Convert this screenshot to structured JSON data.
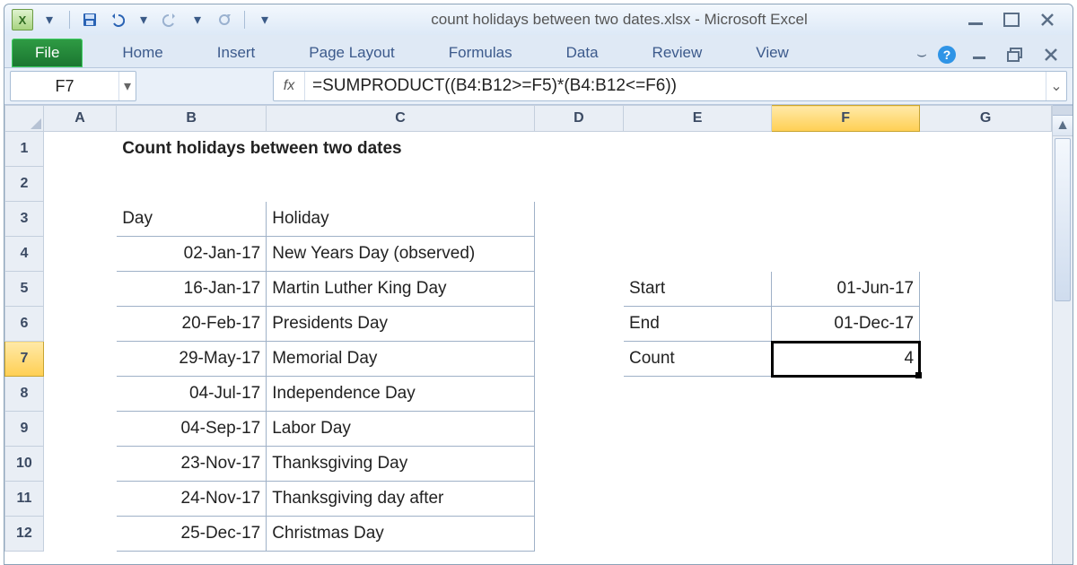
{
  "app": {
    "title": "count holidays between two dates.xlsx - Microsoft Excel"
  },
  "qat": {
    "excel_glyph": "X",
    "dd1": "▾",
    "dd2": "▾",
    "dd3": "▾"
  },
  "win": {
    "min": "▭",
    "max": "▢",
    "close": "✕",
    "help": "?",
    "caret": "▾",
    "sub_min": "—",
    "sub_max": "❐",
    "sub_close": "✕"
  },
  "ribbon": {
    "file": "File",
    "tabs": [
      "Home",
      "Insert",
      "Page Layout",
      "Formulas",
      "Data",
      "Review",
      "View"
    ]
  },
  "namebox": {
    "value": "F7",
    "dd": "▾"
  },
  "formula": {
    "fx": "fx",
    "value": "=SUMPRODUCT((B4:B12>=F5)*(B4:B12<=F6))",
    "expand": "⌄"
  },
  "cols": {
    "A": "A",
    "B": "B",
    "C": "C",
    "D": "D",
    "E": "E",
    "F": "F",
    "G": "G"
  },
  "rows": [
    "1",
    "2",
    "3",
    "4",
    "5",
    "6",
    "7",
    "8",
    "9",
    "10",
    "11",
    "12"
  ],
  "sheet": {
    "title": "Count holidays between two dates",
    "hdr_day": "Day",
    "hdr_holiday": "Holiday",
    "holidays": [
      {
        "day": "02-Jan-17",
        "name": "New Years Day (observed)"
      },
      {
        "day": "16-Jan-17",
        "name": "Martin Luther King Day"
      },
      {
        "day": "20-Feb-17",
        "name": "Presidents Day"
      },
      {
        "day": "29-May-17",
        "name": "Memorial Day"
      },
      {
        "day": "04-Jul-17",
        "name": "Independence Day"
      },
      {
        "day": "04-Sep-17",
        "name": "Labor Day"
      },
      {
        "day": "23-Nov-17",
        "name": "Thanksgiving Day"
      },
      {
        "day": "24-Nov-17",
        "name": "Thanksgiving day after"
      },
      {
        "day": "25-Dec-17",
        "name": "Christmas Day"
      }
    ],
    "start_label": "Start",
    "start_val": "01-Jun-17",
    "end_label": "End",
    "end_val": "01-Dec-17",
    "count_label": "Count",
    "count_val": "4"
  },
  "scroll": {
    "up": "▲",
    "down": "▼"
  },
  "colors": {
    "accent": "#ffcf53",
    "ribbon": "#dfe9f5",
    "file": "#1e7a32"
  }
}
